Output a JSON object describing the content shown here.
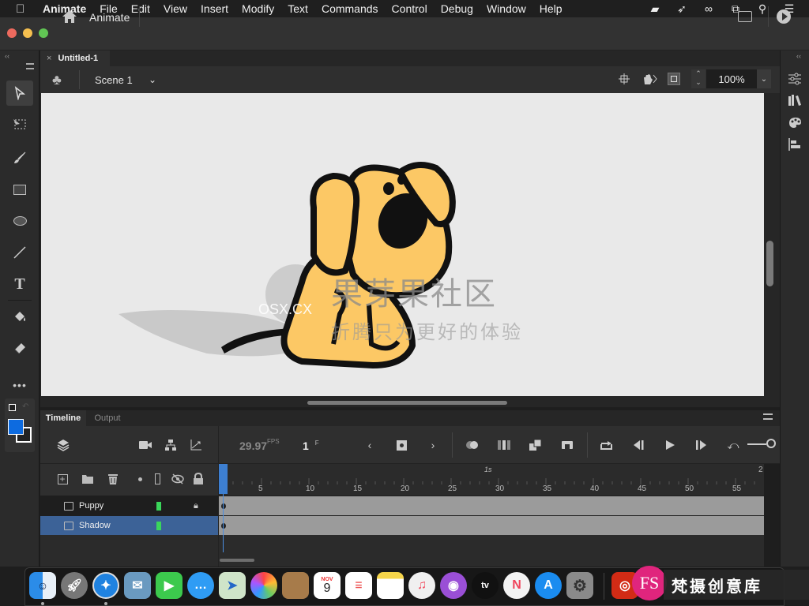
{
  "menubar": {
    "apple": "",
    "items": [
      "Animate",
      "File",
      "Edit",
      "View",
      "Insert",
      "Modify",
      "Text",
      "Commands",
      "Control",
      "Debug",
      "Window",
      "Help"
    ],
    "tray": [
      "screen-share-icon",
      "cursor-pro-icon",
      "creative-cloud-icon",
      "display-mirror-icon",
      "spotlight-search-icon",
      "control-center-list-icon"
    ]
  },
  "app": {
    "title": "Animate",
    "colors": {
      "close": "#ed6a5e",
      "minimize": "#f5bf4f",
      "zoom": "#61c554",
      "accent": "#3d7fd1"
    }
  },
  "document": {
    "tab_close": "×",
    "tab_title": "Untitled-1",
    "scene": "Scene 1",
    "zoom": "100%"
  },
  "tools": [
    "selection",
    "free-transform",
    "paint-brush",
    "rectangle",
    "oval",
    "line",
    "text",
    "paint-bucket",
    "eraser",
    "more"
  ],
  "colors": {
    "fill": "#0d6be0",
    "stroke": "#222222"
  },
  "stage": {
    "watermark_title": "果芽果社区",
    "watermark_sub": "折腾只为更好的体验",
    "watermark_site": "OSX.CX"
  },
  "timeline": {
    "tabs": [
      "Timeline",
      "Output"
    ],
    "fps": "29.97",
    "fps_unit": "FPS",
    "frame": "1",
    "frame_unit": "F",
    "ruler_ticks": [
      "5",
      "10",
      "15",
      "20",
      "25",
      "30",
      "35",
      "40",
      "45",
      "50",
      "55"
    ],
    "seconds": [
      "1s",
      "2"
    ],
    "layers": [
      {
        "name": "Puppy",
        "color": "#3ad65b",
        "locked": true,
        "selected": false
      },
      {
        "name": "Shadow",
        "color": "#3ad65b",
        "locked": false,
        "selected": true
      }
    ]
  },
  "dock": {
    "apps": [
      "Finder",
      "Launchpad",
      "Safari",
      "Mail",
      "FaceTime",
      "Messages",
      "Maps",
      "Photos",
      "Contacts",
      "Calendar",
      "Reminders",
      "Notes",
      "Music",
      "Podcasts",
      "TV",
      "News",
      "App Store",
      "System Preferences",
      "Adobe Animate"
    ],
    "calendar_month": "NOV",
    "calendar_day": "9",
    "tv_label": "tv"
  },
  "watermark": {
    "badge": "FS",
    "text": "梵摄创意库"
  }
}
